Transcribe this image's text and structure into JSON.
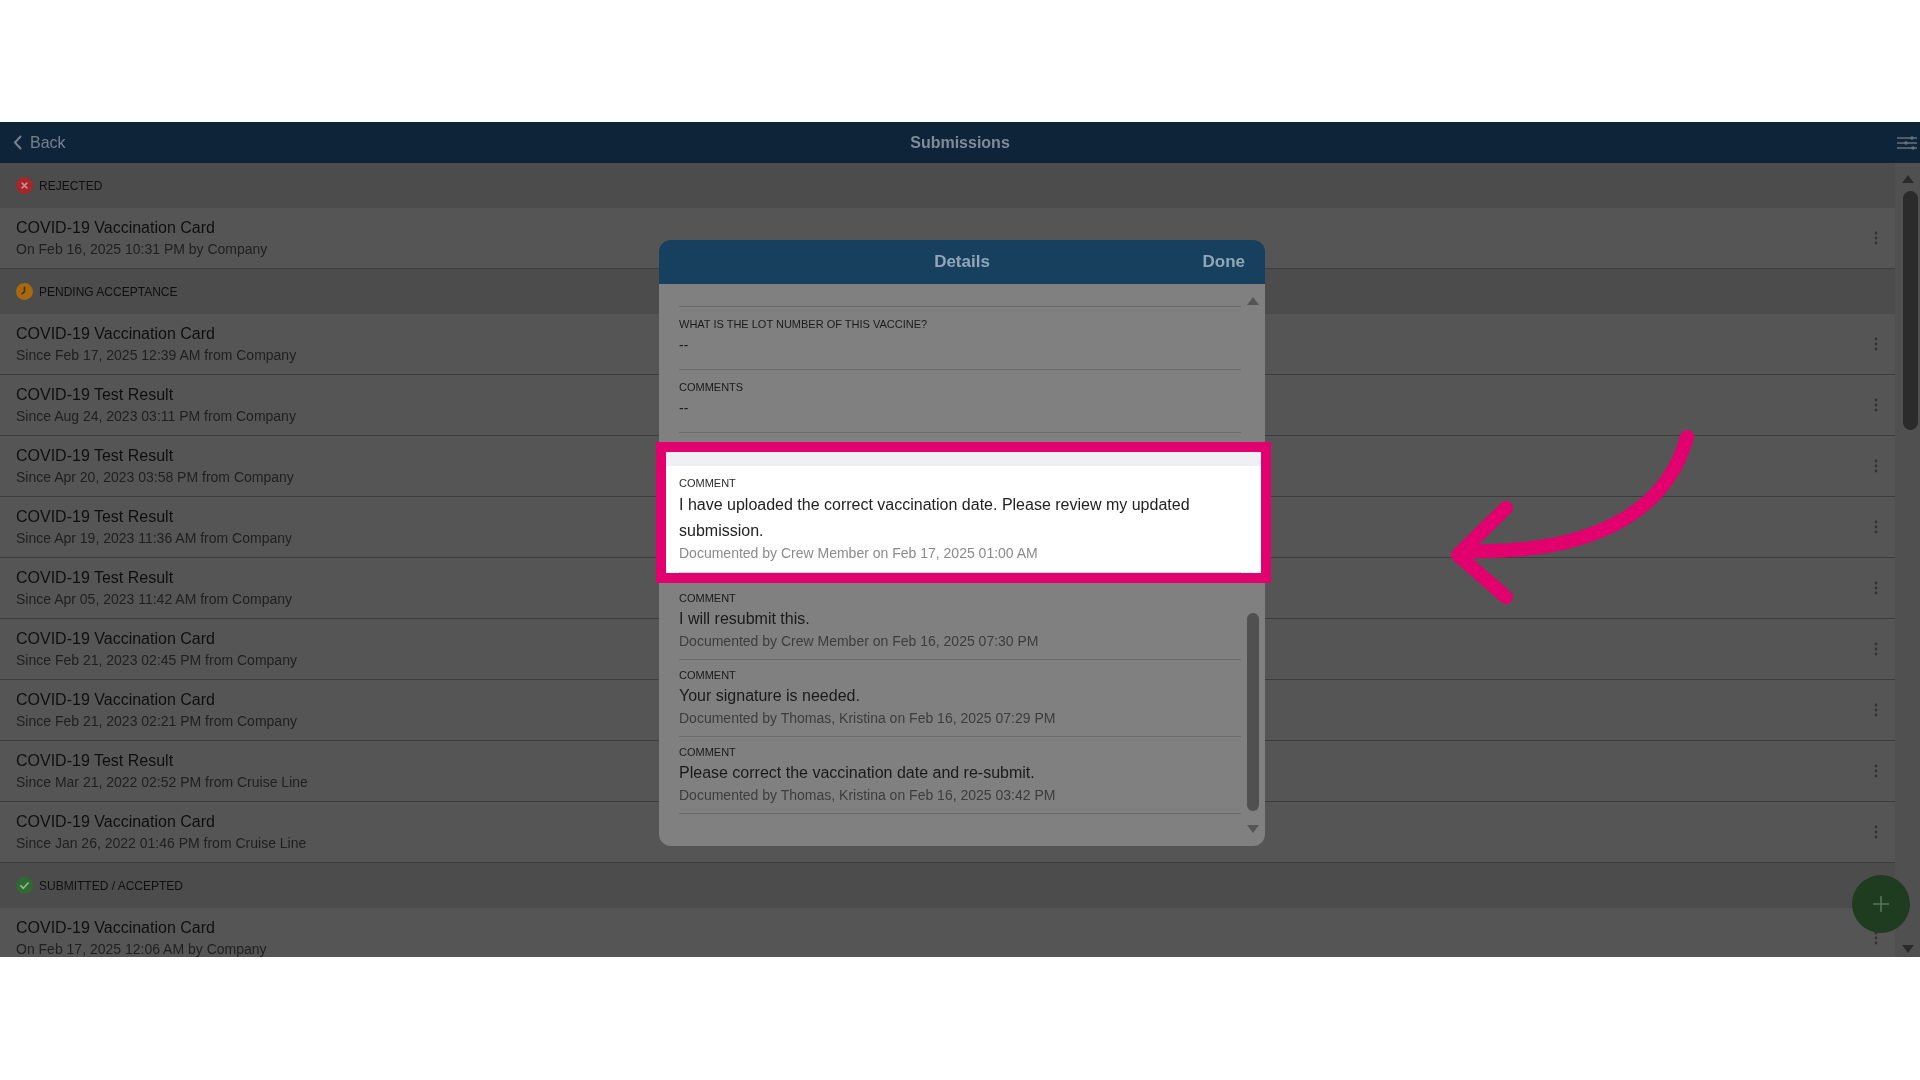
{
  "header": {
    "back_label": "Back",
    "title": "Submissions"
  },
  "sections": [
    {
      "title": "REJECTED",
      "kind": "rejected",
      "color": "#a3272b",
      "items": [
        {
          "title": "COVID-19 Vaccination Card",
          "subtitle": "On Feb 16, 2025 10:31 PM by Company"
        }
      ]
    },
    {
      "title": "PENDING ACCEPTANCE",
      "kind": "pending",
      "color": "#a7690f",
      "items": [
        {
          "title": "COVID-19 Vaccination Card",
          "subtitle": "Since Feb 17, 2025 12:39 AM from Company"
        },
        {
          "title": "COVID-19 Test Result",
          "subtitle": "Since Aug 24, 2023 03:11 PM from Company"
        },
        {
          "title": "COVID-19 Test Result",
          "subtitle": "Since Apr 20, 2023 03:58 PM from Company"
        },
        {
          "title": "COVID-19 Test Result",
          "subtitle": "Since Apr 19, 2023 11:36 AM from Company"
        },
        {
          "title": "COVID-19 Test Result",
          "subtitle": "Since Apr 05, 2023 11:42 AM from Company"
        },
        {
          "title": "COVID-19 Vaccination Card",
          "subtitle": "Since Feb 21, 2023 02:45 PM from Company"
        },
        {
          "title": "COVID-19 Vaccination Card",
          "subtitle": "Since Feb 21, 2023 02:21 PM from Company"
        },
        {
          "title": "COVID-19 Test Result",
          "subtitle": "Since Mar 21, 2022 02:52 PM from Cruise Line"
        },
        {
          "title": "COVID-19 Vaccination Card",
          "subtitle": "Since Jan 26, 2022 01:46 PM from Cruise Line"
        }
      ]
    },
    {
      "title": "SUBMITTED / ACCEPTED",
      "kind": "accepted",
      "color": "#2e6b31",
      "items": [
        {
          "title": "COVID-19 Vaccination Card",
          "subtitle": "On Feb 17, 2025 12:06 AM by Company"
        }
      ]
    }
  ],
  "dialog": {
    "title": "Details",
    "done_label": "Done",
    "fields": [
      {
        "label": "WHAT IS THE LOT NUMBER OF THIS VACCINE?",
        "value": "--"
      },
      {
        "label": "COMMENTS",
        "value": "--"
      }
    ],
    "comments": [
      {
        "label": "COMMENT",
        "text": "I have uploaded the correct vaccination date. Please review my updated submission.",
        "meta": "Documented by Crew Member on Feb 17, 2025 01:00 AM",
        "highlighted": true
      },
      {
        "label": "COMMENT",
        "text": "I will resubmit this.",
        "meta": "Documented by Crew Member on Feb 16, 2025 07:30 PM",
        "highlighted": false
      },
      {
        "label": "COMMENT",
        "text": "Your signature is needed.",
        "meta": "Documented by Thomas, Kristina on Feb 16, 2025 07:29 PM",
        "highlighted": false
      },
      {
        "label": "COMMENT",
        "text": "Please correct the vaccination date and re-submit.",
        "meta": "Documented by Thomas, Kristina on Feb 16, 2025 03:42 PM",
        "highlighted": false
      }
    ]
  }
}
